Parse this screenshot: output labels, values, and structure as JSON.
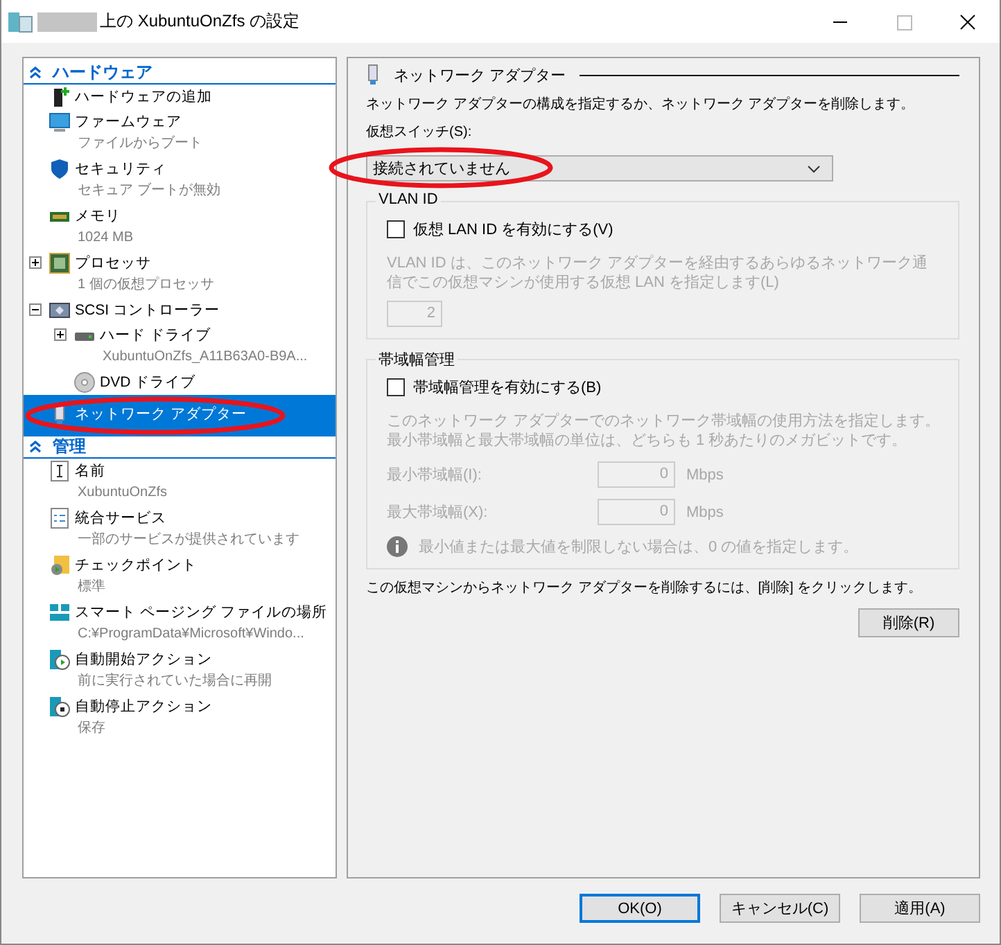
{
  "window": {
    "title": "上の XubuntuOnZfs の設定"
  },
  "sidebar": {
    "sections": [
      {
        "title": "ハードウェア",
        "items": [
          {
            "kind": "add",
            "name": "ハードウェアの追加",
            "selected": false
          },
          {
            "kind": "firmware",
            "name": "ファームウェア",
            "sub": "ファイルからブート",
            "selected": false
          },
          {
            "kind": "security",
            "name": "セキュリティ",
            "sub": "セキュア ブートが無効",
            "selected": false
          },
          {
            "kind": "memory",
            "name": "メモリ",
            "sub": "1024 MB",
            "selected": false
          },
          {
            "kind": "processor",
            "name": "プロセッサ",
            "sub": "1 個の仮想プロセッサ",
            "selected": false,
            "expanded": false
          },
          {
            "kind": "scsi",
            "name": "SCSI コントローラー",
            "selected": false,
            "expanded": true,
            "children": [
              {
                "kind": "disk",
                "name": "ハード ドライブ",
                "sub": "XubuntuOnZfs_A11B63A0-B9A...",
                "selected": false,
                "expanded": false
              },
              {
                "kind": "dvd",
                "name": "DVD ドライブ",
                "selected": false
              }
            ]
          },
          {
            "kind": "network",
            "name": "ネットワーク アダプター",
            "selected": true
          }
        ]
      },
      {
        "title": "管理",
        "items": [
          {
            "kind": "name",
            "name": "名前",
            "sub": "XubuntuOnZfs",
            "selected": false
          },
          {
            "kind": "integration",
            "name": "統合サービス",
            "sub": "一部のサービスが提供されています",
            "selected": false
          },
          {
            "kind": "checkpoint",
            "name": "チェックポイント",
            "sub": "標準",
            "selected": false
          },
          {
            "kind": "paging",
            "name": "スマート ページング ファイルの場所",
            "sub": "C:¥ProgramData¥Microsoft¥Windo...",
            "selected": false
          },
          {
            "kind": "autostart",
            "name": "自動開始アクション",
            "sub": "前に実行されていた場合に再開",
            "selected": false
          },
          {
            "kind": "autostop",
            "name": "自動停止アクション",
            "sub": "保存",
            "selected": false
          }
        ]
      }
    ]
  },
  "panel": {
    "title": "ネットワーク アダプター",
    "description": "ネットワーク アダプターの構成を指定するか、ネットワーク アダプターを削除します。",
    "switch_label": "仮想スイッチ(S):",
    "switch_value": "接続されていません",
    "vlan": {
      "title": "VLAN ID",
      "checkbox": {
        "label": "仮想 LAN ID を有効にする(V)",
        "checked": false
      },
      "help": "VLAN ID は、このネットワーク アダプターを経由するあらゆるネットワーク通信でこの仮想マシンが使用する仮想 LAN を指定します(L)",
      "value": "2"
    },
    "bandwidth": {
      "title": "帯域幅管理",
      "checkbox": {
        "label": "帯域幅管理を有効にする(B)",
        "checked": false
      },
      "help": "このネットワーク アダプターでのネットワーク帯域幅の使用方法を指定します。最小帯域幅と最大帯域幅の単位は、どちらも 1 秒あたりのメガビットです。",
      "fields": [
        {
          "label": "最小帯域幅(I):",
          "value": "0",
          "unit": "Mbps"
        },
        {
          "label": "最大帯域幅(X):",
          "value": "0",
          "unit": "Mbps"
        }
      ],
      "note": "最小値または最大値を制限しない場合は、0 の値を指定します。"
    },
    "remove_text": "この仮想マシンからネットワーク アダプターを削除するには、[削除] をクリックします。",
    "remove_button": "削除(R)"
  },
  "buttons": [
    {
      "label": "OK(O)",
      "default": true
    },
    {
      "label": "キャンセル(C)",
      "default": false
    },
    {
      "label": "適用(A)",
      "default": false
    }
  ]
}
